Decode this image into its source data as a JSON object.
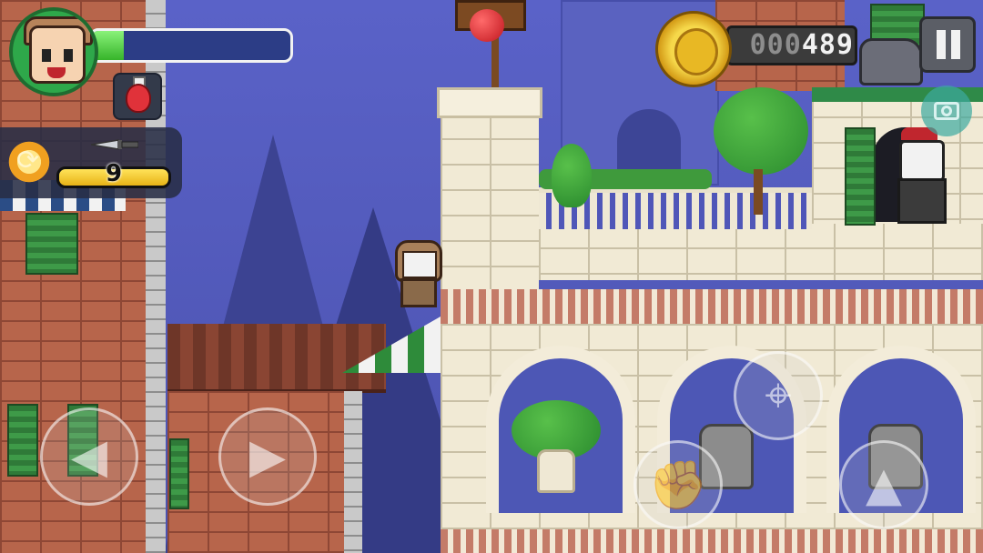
{
  "hud": {
    "player_portrait": "hero-portrait",
    "health_fraction": 0.16,
    "potion_icon": "red-potion-icon",
    "weapon": {
      "swap_icon": "swap-arrows-icon",
      "weapon_icon": "knife-icon",
      "ammo_count": "9",
      "ammo_fraction": 1.0
    },
    "coins": {
      "coin_icon": "gold-coin-icon",
      "count_leading": "000",
      "count_value": "489"
    },
    "pause_icon": "pause-icon",
    "camera_icon": "camera-icon"
  },
  "controls": {
    "move_left": "left-arrow-icon",
    "move_right": "right-arrow-icon",
    "aim": "crosshair-icon",
    "attack": "fist-icon",
    "jump": "jump-arrow-icon"
  },
  "colors": {
    "health": "#4ed33a",
    "ammo": "#f2c51d",
    "sky": "#4f56b8"
  }
}
